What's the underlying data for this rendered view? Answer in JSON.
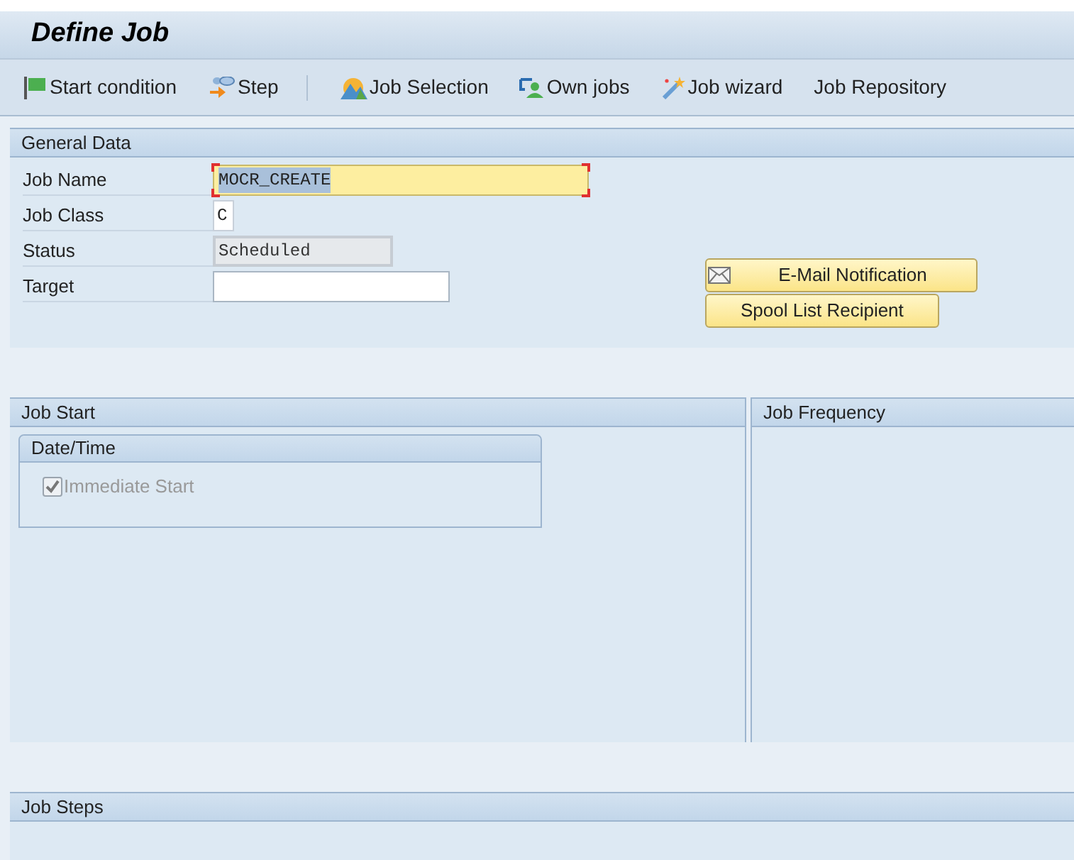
{
  "title": "Define Job",
  "toolbar": [
    {
      "label": "Start condition",
      "kind": "flag"
    },
    {
      "label": "Step",
      "kind": "step"
    },
    {
      "label": "Job Selection",
      "kind": "mountain"
    },
    {
      "label": "Own jobs",
      "kind": "person"
    },
    {
      "label": "Job wizard",
      "kind": "wand"
    },
    {
      "label": "Job Repository",
      "kind": "plain"
    }
  ],
  "general_data": {
    "title": "General Data",
    "fields": [
      {
        "label": "Job Name",
        "value": "MOCR_CREATE",
        "kind": "required",
        "selected": true
      },
      {
        "label": "Job Class",
        "value": "C",
        "kind": "short",
        "selected": false
      },
      {
        "label": "Status",
        "value": "Scheduled",
        "kind": "readonly",
        "selected": false
      },
      {
        "label": "Target",
        "kind": "input",
        "selected": false
      }
    ],
    "buttons": [
      {
        "label": "E-Mail Notification",
        "kind": "envelope"
      },
      {
        "label": "Spool List Recipient",
        "kind": "plain"
      }
    ]
  },
  "job_start": {
    "title": "Job Start",
    "group": {
      "title": "Date/Time",
      "checkbox": {
        "label": "Immediate Start",
        "checked": true,
        "disabled": true
      }
    }
  },
  "job_frequency": {
    "title": "Job Frequency"
  },
  "job_steps": {
    "title": "Job Steps"
  }
}
